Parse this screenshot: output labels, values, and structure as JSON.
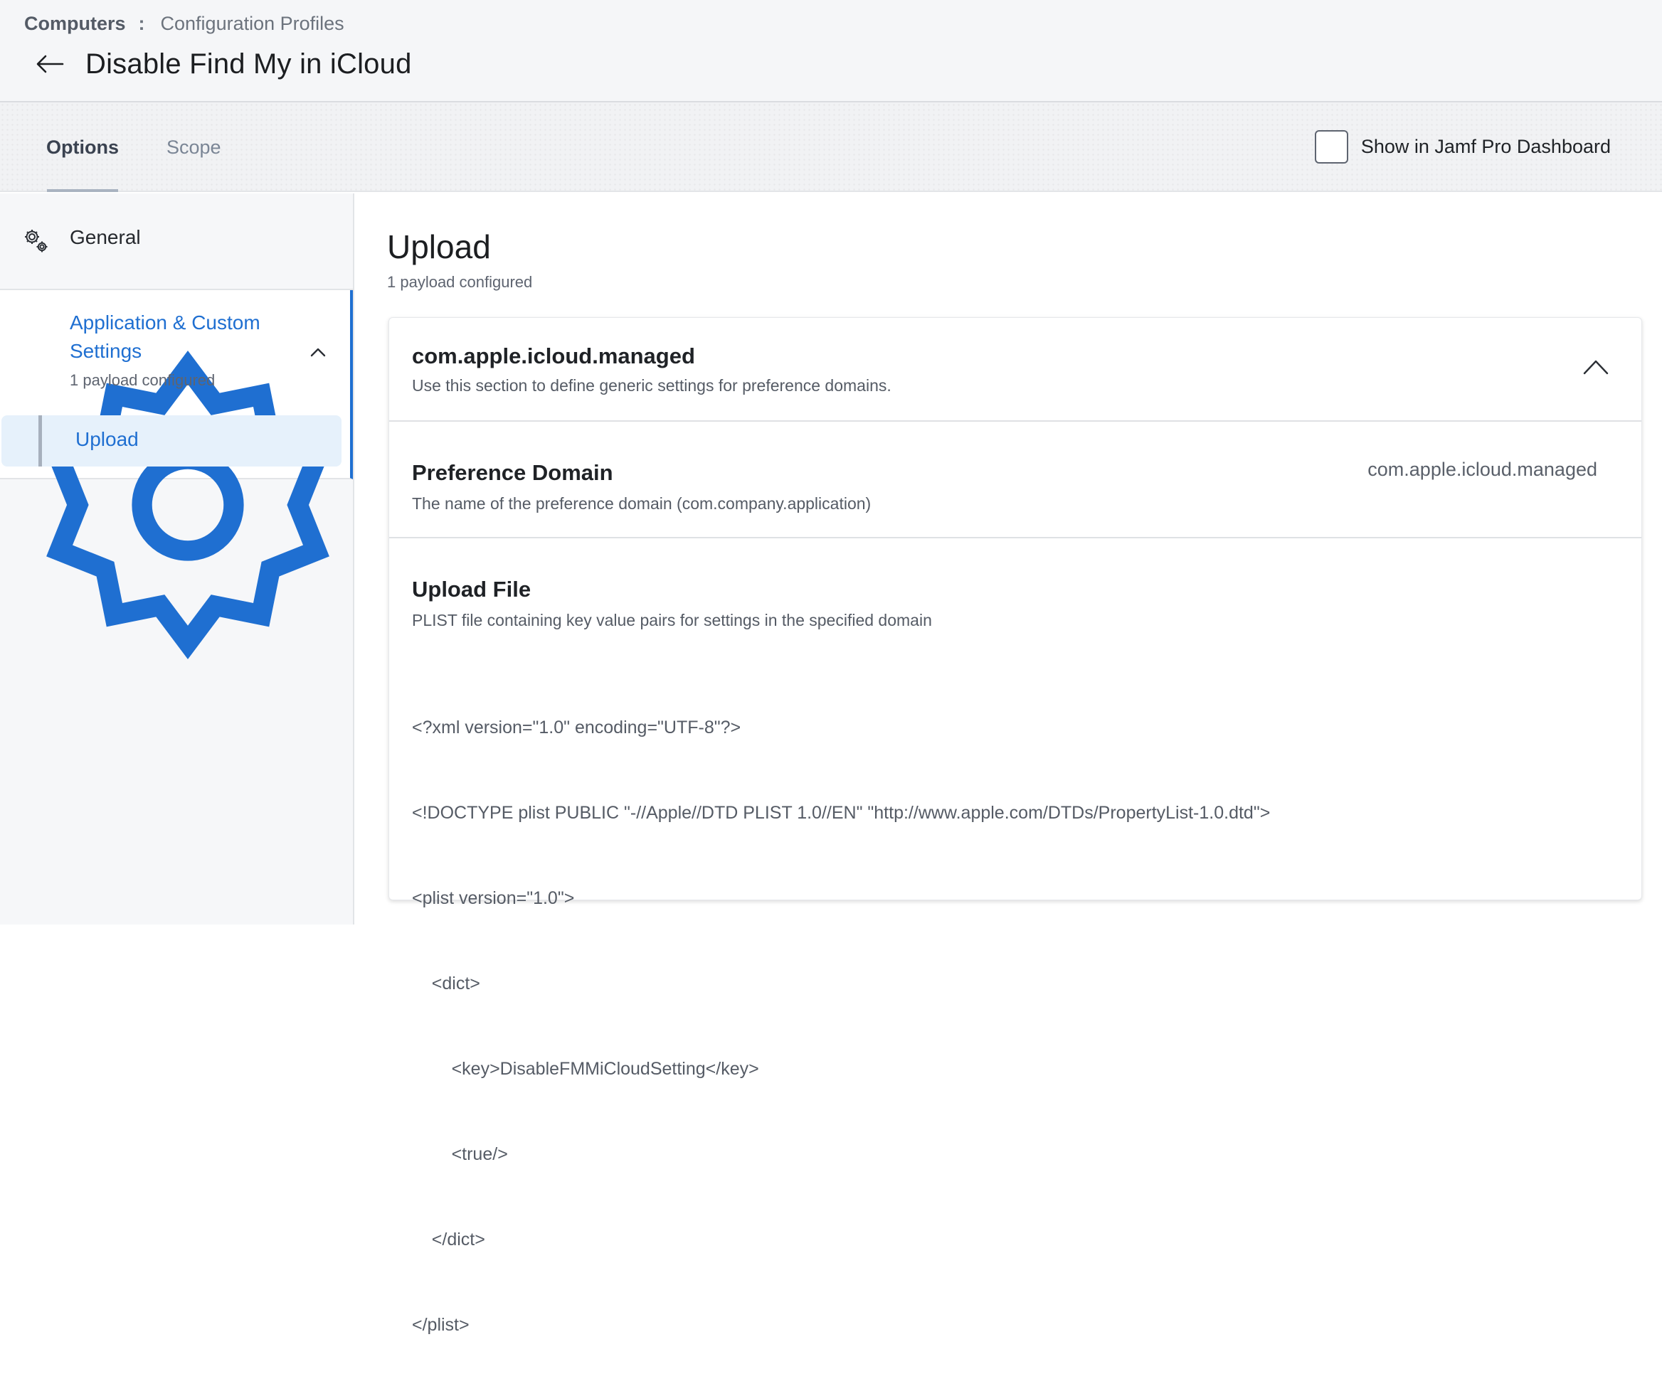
{
  "breadcrumb": {
    "root": "Computers",
    "separator": ":",
    "page": "Configuration Profiles"
  },
  "header": {
    "title": "Disable Find My in iCloud"
  },
  "tabs": [
    {
      "label": "Options",
      "active": true
    },
    {
      "label": "Scope",
      "active": false
    }
  ],
  "dashboard_toggle": {
    "label": "Show in Jamf Pro Dashboard",
    "checked": false
  },
  "sidebar": {
    "general": {
      "label": "General",
      "icon": "gears-icon"
    },
    "group": {
      "title": "Application & Custom Settings",
      "subtitle": "1 payload configured",
      "icon": "gear-icon",
      "expanded": true,
      "items": [
        {
          "label": "Upload",
          "selected": true
        }
      ]
    }
  },
  "main": {
    "title": "Upload",
    "subtitle": "1 payload configured",
    "card": {
      "name": "com.apple.icloud.managed",
      "description": "Use this section to define generic settings for preference domains.",
      "preference_domain": {
        "label": "Preference Domain",
        "description": "The name of the preference domain (com.company.application)",
        "value": "com.apple.icloud.managed"
      },
      "upload_file": {
        "label": "Upload File",
        "description": "PLIST file containing key value pairs for settings in the specified domain",
        "lines": [
          "<?xml version=\"1.0\" encoding=\"UTF-8\"?>",
          "<!DOCTYPE plist PUBLIC \"-//Apple//DTD PLIST 1.0//EN\" \"http://www.apple.com/DTDs/PropertyList-1.0.dtd\">",
          "<plist version=\"1.0\">",
          "    <dict>",
          "        <key>DisableFMMiCloudSetting</key>",
          "        <true/>",
          "    </dict>",
          "</plist>"
        ]
      }
    }
  },
  "colors": {
    "accent": "#1f6fd1",
    "header_bg": "#f5f6f8",
    "selected_bg": "#e6f1fb"
  }
}
